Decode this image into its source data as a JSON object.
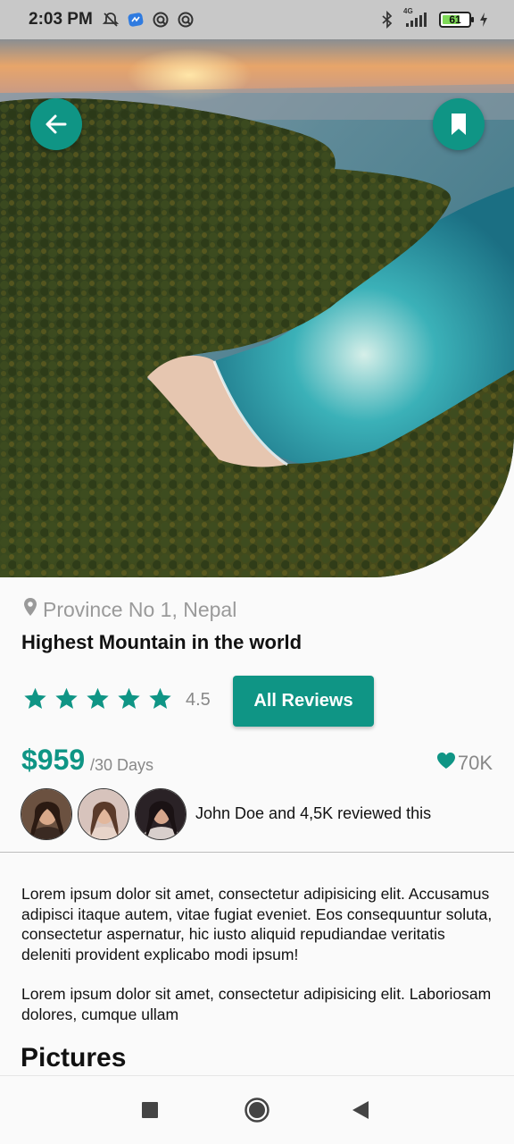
{
  "status_bar": {
    "time": "2:03 PM",
    "network": "4G",
    "battery": "61",
    "icons_left": [
      "muted-notification-icon",
      "app-badge-icon",
      "sync-icon",
      "sync-icon"
    ],
    "icons_right": [
      "bluetooth-icon",
      "signal-icon",
      "battery-icon",
      "charging-icon"
    ]
  },
  "hero": {
    "image": "aerial-coast-forest-beach-photo",
    "back_icon": "arrow-left-icon",
    "bookmark_icon": "bookmark-icon"
  },
  "place": {
    "location": "Province No 1, Nepal",
    "title": "Highest Mountain in the world",
    "rating": "4.5",
    "stars": 5,
    "reviews_button": "All Reviews",
    "price": "$959",
    "price_unit": "/30 Days",
    "likes": "70K",
    "reviewed_text": "John Doe and 4,5K reviewed this"
  },
  "description": {
    "paragraph_1": "Lorem ipsum dolor sit amet, consectetur adipisicing elit. Accusamus adipisci itaque autem, vitae fugiat eveniet. Eos consequuntur soluta, consectetur aspernatur, hic iusto aliquid repudiandae veritatis deleniti provident explicabo modi ipsum!",
    "paragraph_2": "Lorem ipsum dolor sit amet, consectetur adipisicing elit. Laboriosam dolores, cumque ullam"
  },
  "section": {
    "pictures_heading": "Pictures"
  },
  "colors": {
    "accent": "#0f9585",
    "muted_text": "#888888"
  }
}
